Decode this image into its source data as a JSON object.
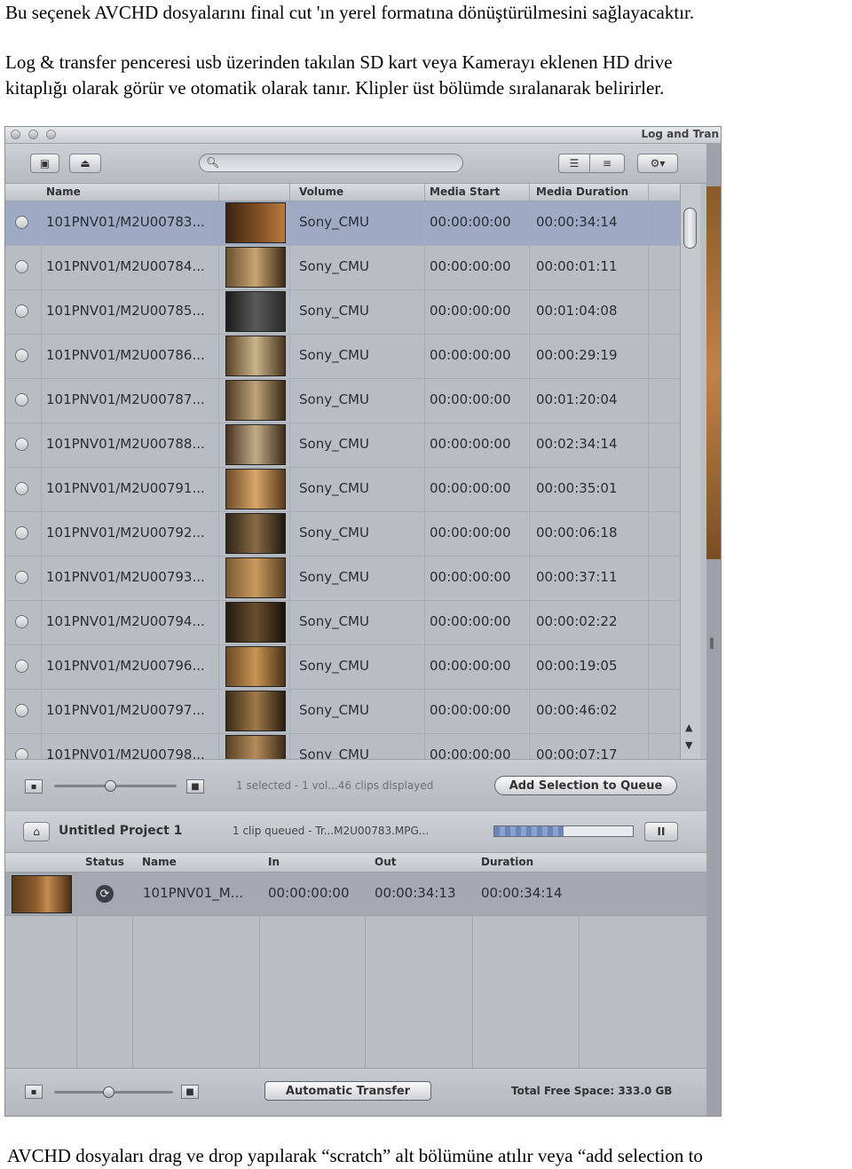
{
  "text": {
    "p1": "Bu seçenek AVCHD dosyalarını final cut 'ın yerel formatına dönüştürülmesini sağlayacaktır.",
    "p2_line1": "Log & transfer  penceresi usb üzerinden takılan SD kart veya Kamerayı eklenen HD drive",
    "p2_line2": "kitaplığı olarak görür ve otomatik olarak tanır. Klipler üst bölümde sıralanarak belirirler.",
    "p3": "AVCHD dosyaları drag ve drop yapılarak “scratch” alt bölümüne atılır veya “add selection to"
  },
  "window": {
    "title": "Log and Tran"
  },
  "toolbar": {
    "icons": [
      "folder-add-icon",
      "eject-icon",
      "search-icon",
      "list-view-icon",
      "thumbnail-view-icon",
      "gear-icon"
    ]
  },
  "browser": {
    "columns": [
      "Name",
      "Volume",
      "Media Start",
      "Media Duration"
    ],
    "clips": [
      {
        "name": "101PNV01/M2U00783...",
        "volume": "Sony_CMU",
        "start": "00:00:00:00",
        "duration": "00:00:34:14",
        "selected": true,
        "thumb": [
          "#3a2412",
          "#7a4b22",
          "#b97a3c"
        ]
      },
      {
        "name": "101PNV01/M2U00784...",
        "volume": "Sony_CMU",
        "start": "00:00:00:00",
        "duration": "00:00:01:11",
        "selected": false,
        "thumb": [
          "#6a5034",
          "#c8a46e",
          "#3c2a18"
        ]
      },
      {
        "name": "101PNV01/M2U00785...",
        "volume": "Sony_CMU",
        "start": "00:00:00:00",
        "duration": "00:01:04:08",
        "selected": false,
        "thumb": [
          "#1a1a1a",
          "#5a5a5a",
          "#2a2a2a"
        ]
      },
      {
        "name": "101PNV01/M2U00786...",
        "volume": "Sony_CMU",
        "start": "00:00:00:00",
        "duration": "00:00:29:19",
        "selected": false,
        "thumb": [
          "#5a4228",
          "#c9b48a",
          "#4a3420"
        ]
      },
      {
        "name": "101PNV01/M2U00787...",
        "volume": "Sony_CMU",
        "start": "00:00:00:00",
        "duration": "00:01:20:04",
        "selected": false,
        "thumb": [
          "#4e3a24",
          "#bfa37a",
          "#3a2a18"
        ]
      },
      {
        "name": "101PNV01/M2U00788...",
        "volume": "Sony_CMU",
        "start": "00:00:00:00",
        "duration": "00:02:34:14",
        "selected": false,
        "thumb": [
          "#473422",
          "#c2ab86",
          "#3c2c1c"
        ]
      },
      {
        "name": "101PNV01/M2U00791...",
        "volume": "Sony_CMU",
        "start": "00:00:00:00",
        "duration": "00:00:35:01",
        "selected": false,
        "thumb": [
          "#6e4a26",
          "#d9a66a",
          "#5a3a1c"
        ]
      },
      {
        "name": "101PNV01/M2U00792...",
        "volume": "Sony_CMU",
        "start": "00:00:00:00",
        "duration": "00:00:06:18",
        "selected": false,
        "thumb": [
          "#2e2418",
          "#8a6a44",
          "#1e1810"
        ]
      },
      {
        "name": "101PNV01/M2U00793...",
        "volume": "Sony_CMU",
        "start": "00:00:00:00",
        "duration": "00:00:37:11",
        "selected": false,
        "thumb": [
          "#7a5a34",
          "#c89a5c",
          "#5a4024"
        ]
      },
      {
        "name": "101PNV01/M2U00794...",
        "volume": "Sony_CMU",
        "start": "00:00:00:00",
        "duration": "00:00:02:22",
        "selected": false,
        "thumb": [
          "#241a10",
          "#6a4e2e",
          "#1a120a"
        ]
      },
      {
        "name": "101PNV01/M2U00796...",
        "volume": "Sony_CMU",
        "start": "00:00:00:00",
        "duration": "00:00:19:05",
        "selected": false,
        "thumb": [
          "#6a4a26",
          "#c89452",
          "#4a3218"
        ]
      },
      {
        "name": "101PNV01/M2U00797...",
        "volume": "Sony_CMU",
        "start": "00:00:00:00",
        "duration": "00:00:46:02",
        "selected": false,
        "thumb": [
          "#3a2a18",
          "#a07a48",
          "#2a1c10"
        ]
      },
      {
        "name": "101PNV01/M2U00798...",
        "volume": "Sony_CMU",
        "start": "00:00:00:00",
        "duration": "00:00:07:17",
        "selected": false,
        "thumb": [
          "#5a4026",
          "#b48c5a",
          "#3e2c1a"
        ]
      }
    ]
  },
  "status": {
    "summary": "1 selected - 1 vol...46 clips displayed",
    "add_button": "Add Selection to Queue"
  },
  "project": {
    "name": "Untitled Project 1",
    "queue_status": "1 clip queued - Tr...M2U00783.MPG...",
    "progress": 0.5,
    "pause_label": "II"
  },
  "queue": {
    "columns": [
      "Status",
      "Name",
      "In",
      "Out",
      "Duration"
    ],
    "items": [
      {
        "name": "101PNV01_M...",
        "in": "00:00:00:00",
        "out": "00:00:34:13",
        "duration": "00:00:34:14",
        "status_icon": "transfer-status-icon"
      }
    ]
  },
  "bottom": {
    "auto_button": "Automatic Transfer",
    "free_space": "Total Free Space: 333.0 GB"
  },
  "colors": {
    "selected_row": "#9eaac4",
    "window_bg": "#b9bdc4"
  }
}
